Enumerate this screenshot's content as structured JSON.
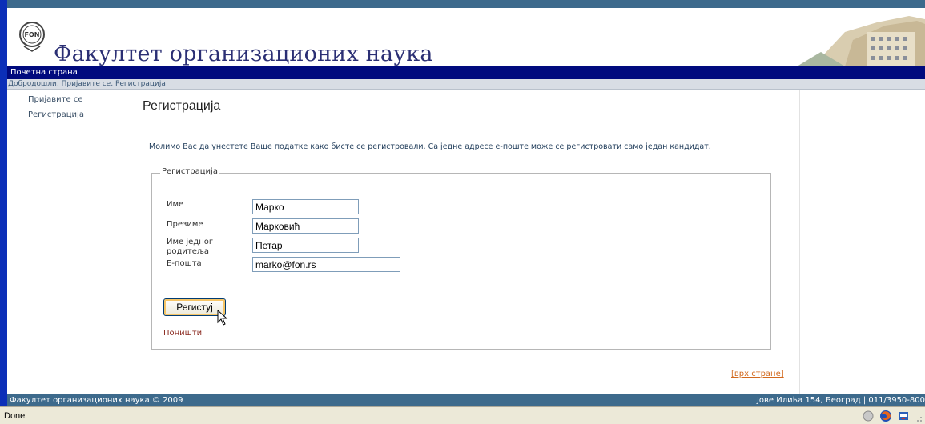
{
  "header": {
    "site_title": "Факултет организационих наука"
  },
  "nav": {
    "home": "Почетна страна"
  },
  "breadcrumb": "Добродошли, Пријавите се, Регистрација",
  "sidebar": {
    "items": [
      {
        "label": "Пријавите се"
      },
      {
        "label": "Регистрација"
      }
    ]
  },
  "main": {
    "title": "Регистрација",
    "intro": "Молимо Вас да унестете Ваше податке како бисте се регистровали. Са једне адресе е-поште може се регистровати само један кандидат."
  },
  "form": {
    "legend": "Регистрација",
    "fields": [
      {
        "label": "Име",
        "value": "Марко"
      },
      {
        "label": "Презиме",
        "value": "Марковић"
      },
      {
        "label": "Име једног родитеља",
        "value": "Петар"
      },
      {
        "label": "Е-пошта",
        "value": "marko@fon.rs"
      }
    ],
    "submit_label": "Регистуј",
    "reset_label": "Поништи"
  },
  "top_link": "[врх стране]",
  "footer": {
    "left": "Факултет организационих наука © 2009",
    "right": "Јове Илића 154, Београд | 011/3950-800"
  },
  "statusbar": {
    "text": "Done"
  },
  "colors": {
    "accent": "#000a7e",
    "frame": "#0b2fb8",
    "footer": "#3d6a8c",
    "link": "#d2691e"
  }
}
